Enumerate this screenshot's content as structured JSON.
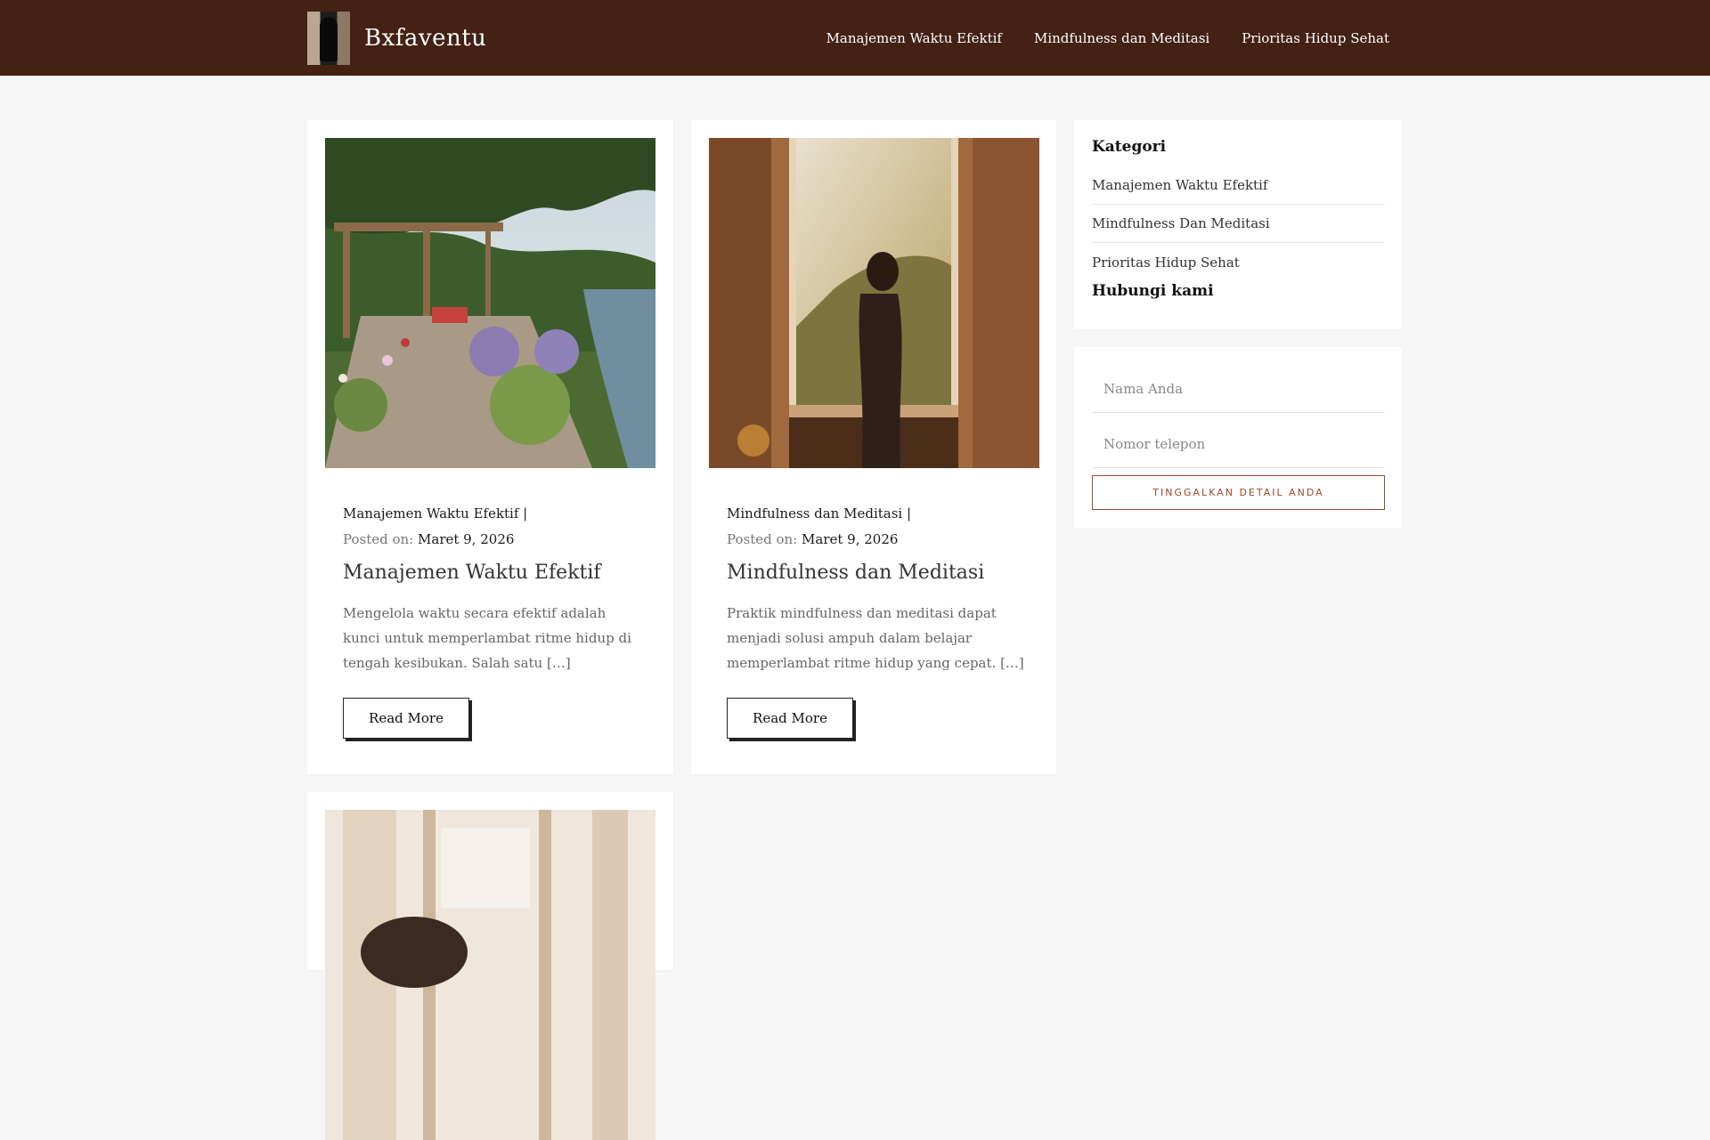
{
  "header": {
    "site_name": "Bxfaventu",
    "logo_icon": "microphone-logo-icon",
    "nav": [
      {
        "label": "Manajemen Waktu Efektif"
      },
      {
        "label": "Mindfulness dan Meditasi"
      },
      {
        "label": "Prioritas Hidup Sehat"
      }
    ],
    "background_color": "#432113"
  },
  "posts": [
    {
      "category": "Manajemen Waktu Efektif |",
      "posted_on_label": "Posted on:",
      "date": "Maret 9, 2026",
      "title": "Manajemen Waktu Efektif",
      "excerpt": "Mengelola waktu secara efektif adalah kunci untuk memperlambat ritme hidup di tengah kesibukan. Salah satu […]",
      "read_more": "Read More",
      "image": "garden-pergola-image"
    },
    {
      "category": "Mindfulness dan Meditasi |",
      "posted_on_label": "Posted on:",
      "date": "Maret 9, 2026",
      "title": "Mindfulness dan Meditasi",
      "excerpt": "Praktik mindfulness dan meditasi dapat menjadi solusi ampuh dalam belajar memperlambat ritme hidup yang cepat. […]",
      "read_more": "Read More",
      "image": "woman-window-sunlight-image"
    },
    {
      "image": "woman-window-portrait-image"
    }
  ],
  "sidebar": {
    "categories_heading": "Kategori",
    "categories": [
      {
        "label": "Manajemen Waktu Efektif"
      },
      {
        "label": "Mindfulness Dan Meditasi"
      },
      {
        "label": "Prioritas Hidup Sehat"
      }
    ],
    "contact_heading": "Hubungi kami",
    "form": {
      "name_placeholder": "Nama Anda",
      "phone_placeholder": "Nomor telepon",
      "submit_label": "TINGGALKAN DETAIL ANDA"
    }
  },
  "colors": {
    "accent": "#9b4a2e",
    "page_background": "#f6f6f6"
  }
}
